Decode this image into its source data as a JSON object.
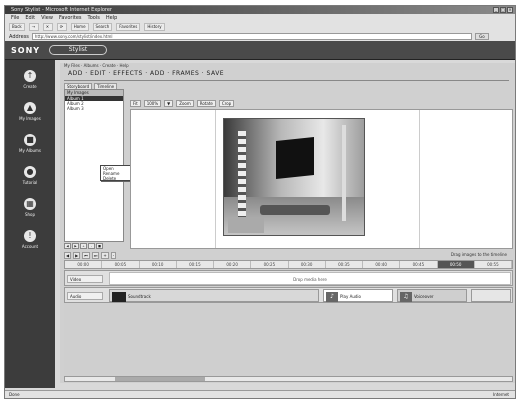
{
  "window": {
    "title": "Sony Stylist - Microsoft Internet Explorer",
    "min": "_",
    "max": "□",
    "close": "×"
  },
  "menubar": [
    "File",
    "Edit",
    "View",
    "Favorites",
    "Tools",
    "Help"
  ],
  "toolbar": [
    "Back",
    "→",
    "✕",
    "⟳",
    "Home",
    "Search",
    "Favorites",
    "History"
  ],
  "address": {
    "label": "Address",
    "value": "http://www.sony.com/stylist/index.html",
    "go": "Go"
  },
  "brand": {
    "sony": "SONY",
    "app": "Stylist"
  },
  "sidebar": {
    "items": [
      {
        "label": "Create",
        "icon": "↑"
      },
      {
        "label": "My Images",
        "icon": "▲"
      },
      {
        "label": "My Albums",
        "icon": "■"
      },
      {
        "label": "Tutorial",
        "icon": "●"
      },
      {
        "label": "Shop",
        "icon": "▦"
      },
      {
        "label": "Account",
        "icon": "!"
      }
    ]
  },
  "main": {
    "breadcrumb": "My Files  ·  Albums  ·  Create  ·  Help",
    "title_tabs": "ADD · EDIT · EFFECTS · ADD · FRAMES · SAVE",
    "subtabs": [
      "Storyboard",
      "Timeline"
    ],
    "tree": {
      "header": "My Images",
      "items": [
        "Album 1",
        "Album 2",
        "Album 3"
      ],
      "context_menu": [
        "Open",
        "Rename",
        "Delete"
      ],
      "nav": [
        "◀",
        "▶",
        "+",
        "-",
        "■"
      ]
    },
    "view_tools": [
      "Fit",
      "100%",
      "▼",
      "Zoom",
      "Rotate",
      "Crop"
    ],
    "filmstrip": {
      "header": [
        "◀",
        "▶",
        "⏮",
        "⏭",
        "+",
        "-"
      ],
      "status": "Drag images to the timeline",
      "slots": [
        "00:00",
        "00:05",
        "00:10",
        "00:15",
        "00:20",
        "00:25",
        "00:30",
        "00:35",
        "00:40",
        "00:45",
        "00:50",
        "00:55"
      ]
    },
    "tracks": [
      {
        "label": "Video",
        "drop": "Drop media here"
      },
      {
        "label": "Audio",
        "clip1": "Soundtrack",
        "clip2": "Play Audio",
        "clip3": "Voiceover"
      }
    ]
  },
  "status": {
    "text": "Done",
    "zone": "Internet"
  }
}
